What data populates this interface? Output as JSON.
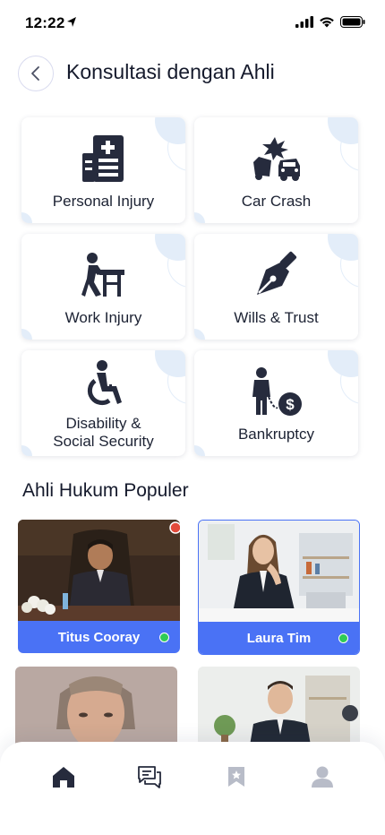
{
  "status": {
    "time": "12:22"
  },
  "header": {
    "title": "Konsultasi dengan Ahli"
  },
  "categories": [
    {
      "label": "Personal Injury",
      "icon": "hospital-icon"
    },
    {
      "label": "Car Crash",
      "icon": "car-crash-icon"
    },
    {
      "label": "Work Injury",
      "icon": "work-injury-icon"
    },
    {
      "label": "Wills & Trust",
      "icon": "pen-nib-icon"
    },
    {
      "label_line1": "Disability &",
      "label_line2": "Social Security",
      "icon": "wheelchair-icon"
    },
    {
      "label": "Bankruptcy",
      "icon": "bankruptcy-icon"
    }
  ],
  "section": {
    "title": "Ahli Hukum Populer"
  },
  "lawyers": [
    {
      "name": "Titus Cooray",
      "online": true
    },
    {
      "name": "Laura Tim",
      "online": true
    }
  ],
  "nav": {
    "items": [
      "home-icon",
      "chat-icon",
      "bookmark-icon",
      "profile-icon"
    ],
    "active": "home-icon"
  },
  "colors": {
    "accent": "#4a72f5",
    "online": "#2fcb56",
    "icon_dark": "#262b3d",
    "icon_muted": "#b8bcc8"
  }
}
